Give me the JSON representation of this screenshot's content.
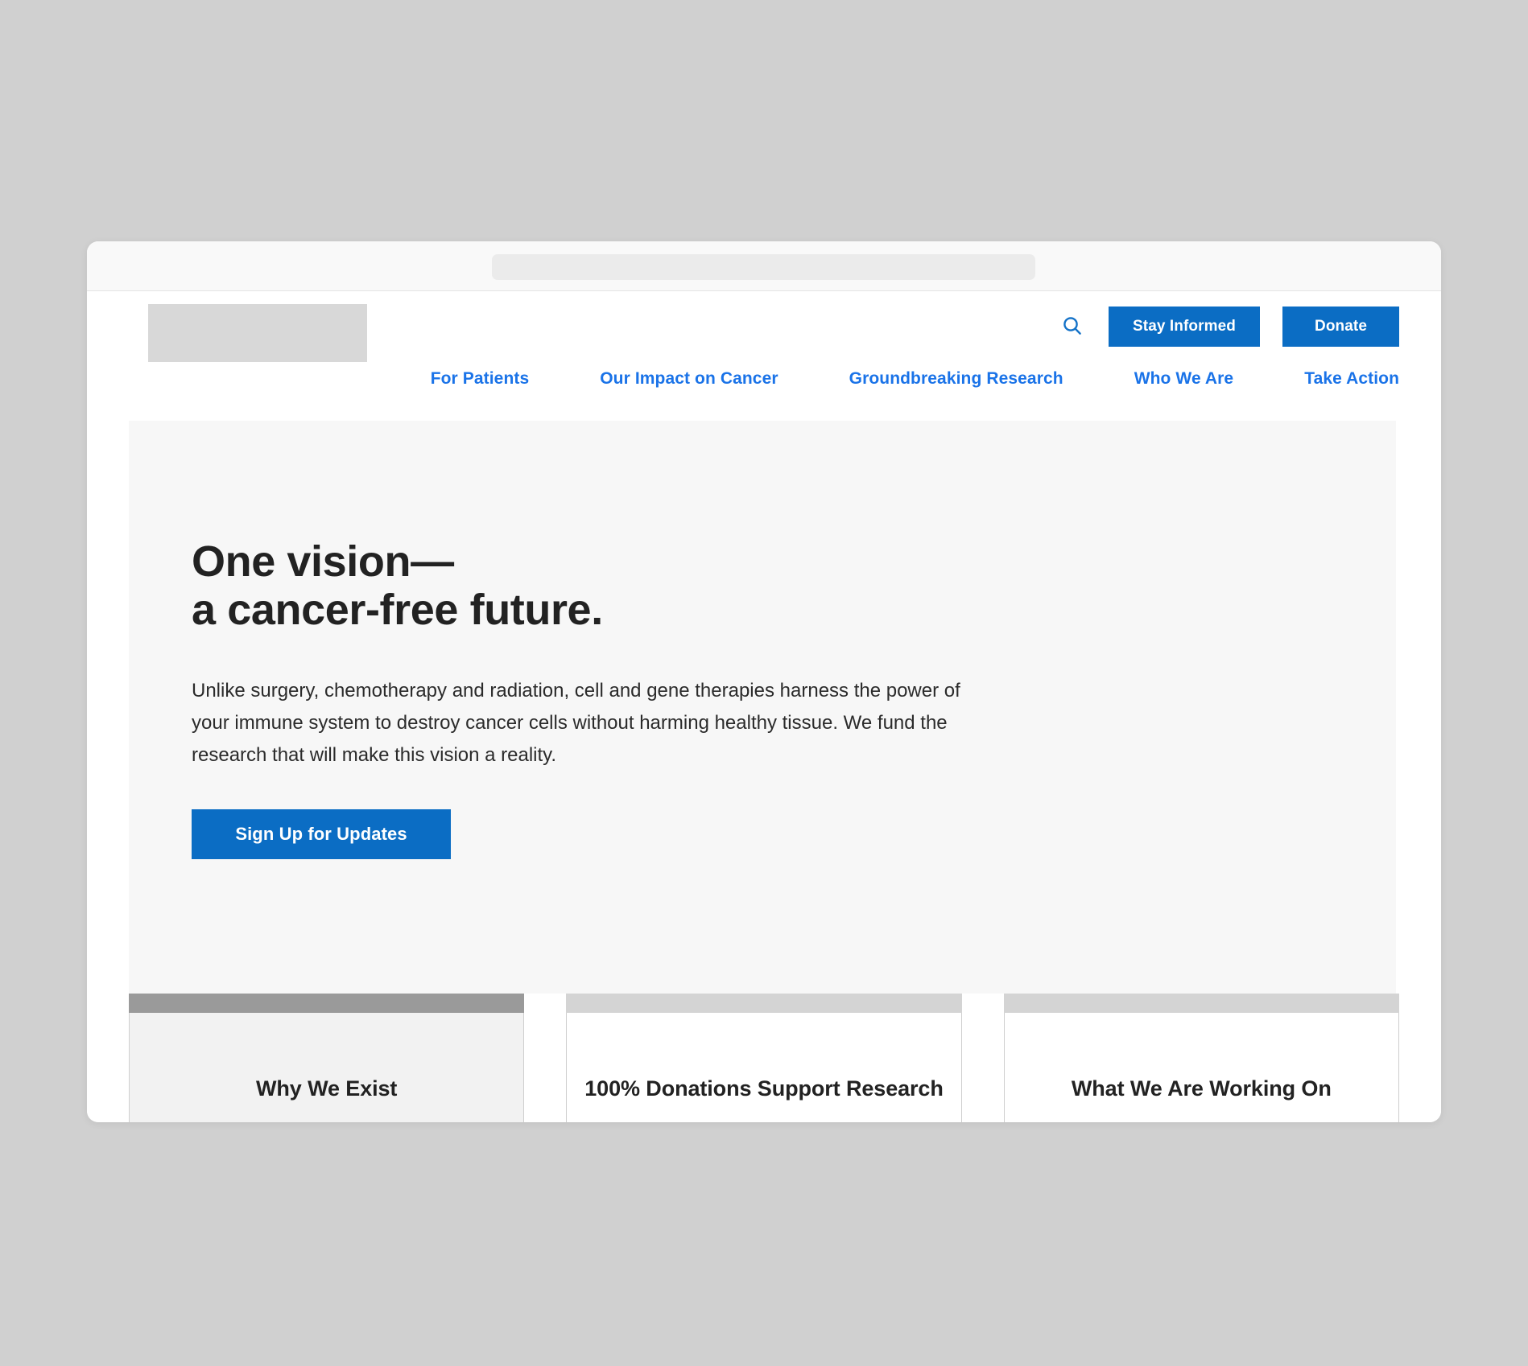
{
  "browser": {
    "address_bar_value": "",
    "address_bar_placeholder": ""
  },
  "colors": {
    "accent_blue": "#0b6dc4",
    "nav_link_blue": "#1a73e8",
    "page_backdrop": "#d0d0d0",
    "hero_background": "#f7f7f7",
    "heading_text": "#222222",
    "card_strip_dark": "#9a9a9a",
    "card_strip_light": "#d4d4d4",
    "card_body_gray": "#f2f2f2",
    "card_body_white": "#ffffff",
    "logo_placeholder": "#d8d8d8"
  },
  "header": {
    "logo": {
      "name": "logo-placeholder",
      "text": ""
    },
    "search": {
      "icon": "search-icon",
      "label": "Search"
    },
    "buttons": [
      {
        "label": "Stay Informed",
        "name": "stay-informed-button"
      },
      {
        "label": "Donate",
        "name": "donate-button"
      }
    ],
    "nav": [
      {
        "label": "For Patients",
        "name": "nav-for-patients"
      },
      {
        "label": "Our Impact on Cancer",
        "name": "nav-our-impact-on-cancer"
      },
      {
        "label": "Groundbreaking Research",
        "name": "nav-groundbreaking-research"
      },
      {
        "label": "Who We Are",
        "name": "nav-who-we-are"
      },
      {
        "label": "Take Action",
        "name": "nav-take-action"
      }
    ]
  },
  "hero": {
    "title_line1": "One vision—",
    "title_line2": "a cancer-free future.",
    "body": "Unlike surgery, chemotherapy and radiation, cell and gene therapies harness the power of your immune system to destroy cancer cells without harming healthy tissue. We fund the research that will make this vision a reality.",
    "cta_label": "Sign Up for Updates"
  },
  "cards": [
    {
      "title": "Why We Exist",
      "strip_color": "#9a9a9a",
      "body_color": "#f2f2f2",
      "name": "card-why-we-exist"
    },
    {
      "title": "100% Donations Support Research",
      "strip_color": "#d4d4d4",
      "body_color": "#ffffff",
      "name": "card-100-donations-support-research"
    },
    {
      "title": "What We Are Working On",
      "strip_color": "#d4d4d4",
      "body_color": "#ffffff",
      "name": "card-what-we-are-working-on"
    }
  ]
}
